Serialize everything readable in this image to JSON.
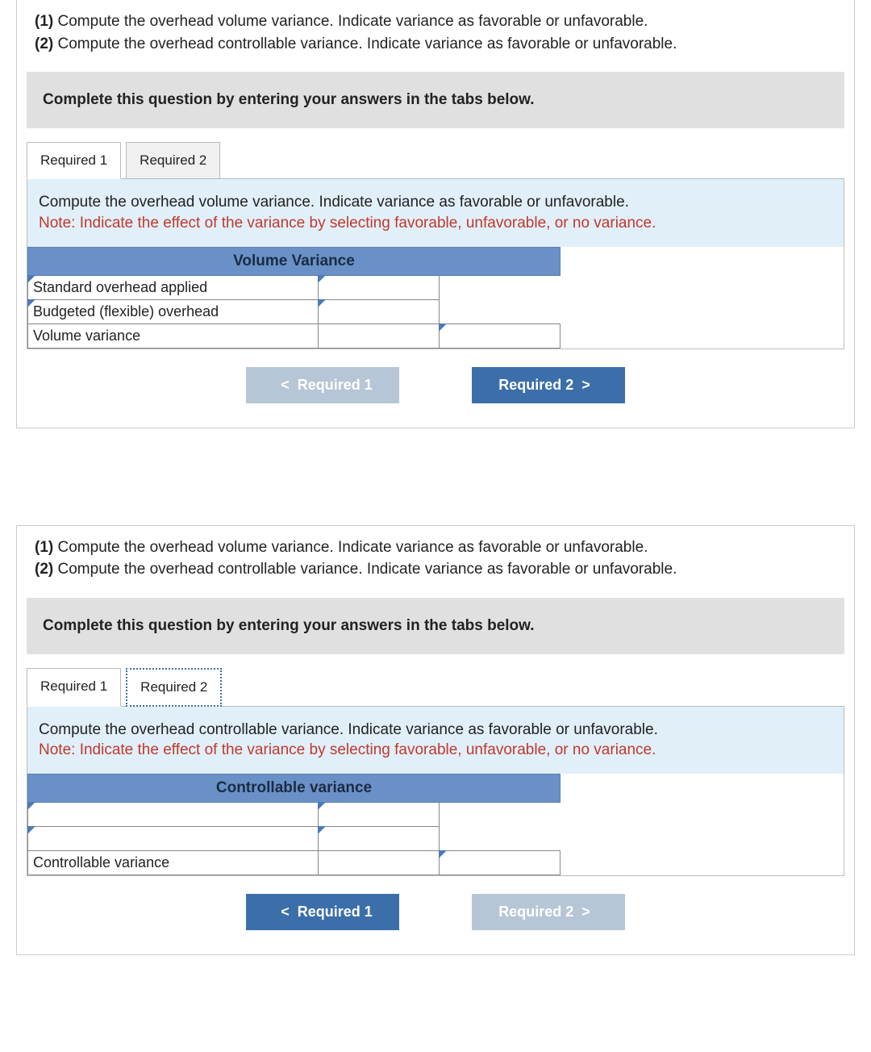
{
  "intro": {
    "line1_label": "(1)",
    "line1_text": "Compute the overhead volume variance. Indicate variance as favorable or unfavorable.",
    "line2_label": "(2)",
    "line2_text": "Compute the overhead controllable variance. Indicate variance as favorable or unfavorable."
  },
  "banner": "Complete this question by entering your answers in the tabs below.",
  "tabs": {
    "req1": "Required 1",
    "req2": "Required 2"
  },
  "panel1": {
    "heading": "Compute the overhead volume variance. Indicate variance as favorable or unfavorable.",
    "note": "Note: Indicate the effect of the variance by selecting favorable, unfavorable, or no variance.",
    "table_title": "Volume Variance",
    "rows": {
      "r1": "Standard overhead applied",
      "r2": "Budgeted (flexible) overhead",
      "r3": "Volume variance"
    }
  },
  "panel2": {
    "heading": "Compute the overhead controllable variance. Indicate variance as favorable or unfavorable.",
    "note": "Note: Indicate the effect of the variance by selecting favorable, unfavorable, or no variance.",
    "table_title": "Controllable variance",
    "rows": {
      "r1": "",
      "r2": "",
      "r3": "Controllable variance"
    }
  },
  "nav": {
    "prev": "Required 1",
    "next": "Required 2",
    "chev_left": "<",
    "chev_right": ">"
  }
}
